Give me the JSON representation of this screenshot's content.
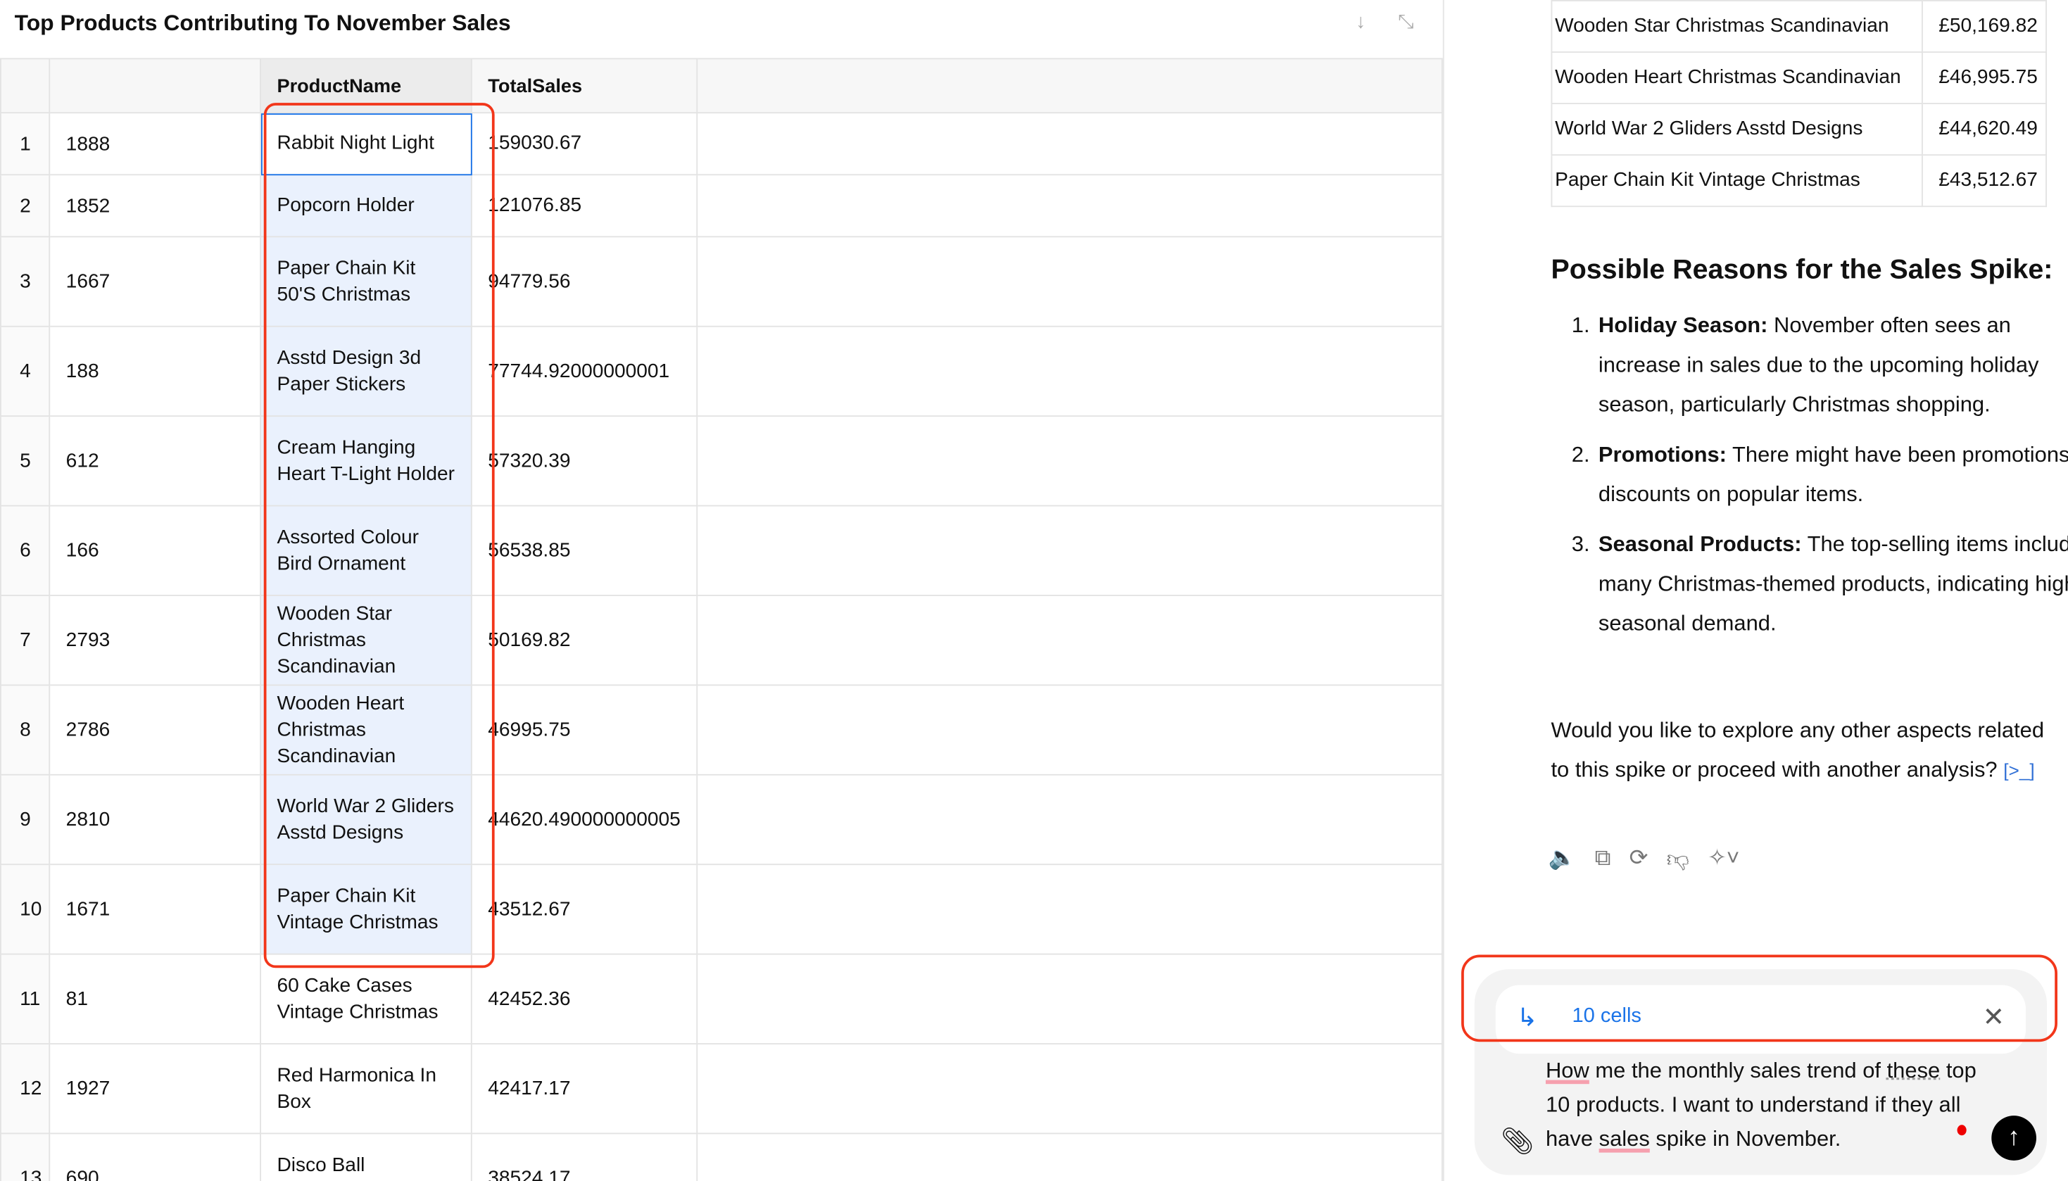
{
  "left": {
    "title": "Top Products Contributing To November Sales",
    "download_icon": "↓",
    "collapse_icon": "⤡",
    "headers": [
      "",
      "",
      "ProductName",
      "TotalSales"
    ],
    "rows": [
      {
        "i": "1",
        "id": "1888",
        "name": "Rabbit Night Light",
        "sales": "159030.67"
      },
      {
        "i": "2",
        "id": "1852",
        "name": "Popcorn Holder",
        "sales": "121076.85"
      },
      {
        "i": "3",
        "id": "1667",
        "name": "Paper Chain Kit 50'S Christmas",
        "sales": "94779.56"
      },
      {
        "i": "4",
        "id": "188",
        "name": "Asstd Design 3d Paper Stickers",
        "sales": "77744.92000000001"
      },
      {
        "i": "5",
        "id": "612",
        "name": "Cream Hanging Heart T-Light Holder",
        "sales": "57320.39"
      },
      {
        "i": "6",
        "id": "166",
        "name": "Assorted Colour Bird Ornament",
        "sales": "56538.85"
      },
      {
        "i": "7",
        "id": "2793",
        "name": "Wooden Star Christmas Scandinavian",
        "sales": "50169.82"
      },
      {
        "i": "8",
        "id": "2786",
        "name": "Wooden Heart Christmas Scandinavian",
        "sales": "46995.75"
      },
      {
        "i": "9",
        "id": "2810",
        "name": "World War 2 Gliders Asstd Designs",
        "sales": "44620.490000000005"
      },
      {
        "i": "10",
        "id": "1671",
        "name": "Paper Chain Kit Vintage Christmas",
        "sales": "43512.67"
      },
      {
        "i": "11",
        "id": "81",
        "name": "60 Cake Cases Vintage Christmas",
        "sales": "42452.36"
      },
      {
        "i": "12",
        "id": "1927",
        "name": "Red Harmonica In Box",
        "sales": "42417.17"
      },
      {
        "i": "13",
        "id": "690",
        "name": "Disco Ball Christmas",
        "sales": "38524.17"
      }
    ]
  },
  "right": {
    "summary": [
      {
        "name": "Wooden Star Christmas Scandinavian",
        "value": "£50,169.82"
      },
      {
        "name": "Wooden Heart Christmas Scandinavian",
        "value": "£46,995.75"
      },
      {
        "name": "World War 2 Gliders Asstd Designs",
        "value": "£44,620.49"
      },
      {
        "name": "Paper Chain Kit Vintage Christmas",
        "value": "£43,512.67"
      }
    ],
    "heading": "Possible Reasons for the Sales Spike:",
    "reasons": [
      {
        "title": "Holiday Season:",
        "text": " November often sees an increase in sales due to the upcoming holiday season, particularly Christmas shopping."
      },
      {
        "title": "Promotions:",
        "text": " There might have been promotions or discounts on popular items."
      },
      {
        "title": "Seasonal Products:",
        "text": " The top-selling items include many Christmas-themed products, indicating high seasonal demand."
      }
    ],
    "followup": "Would you like to explore any other aspects related to this spike or proceed with another analysis?",
    "cite": "[>_]",
    "chip_label": "10 cells",
    "message": {
      "w1": "How",
      "w2": " me the monthly sales trend of ",
      "w3": "these",
      "w4": " top 10 products. I want to understand if they all have ",
      "w5": "sales",
      "w6": " spike in November."
    }
  }
}
